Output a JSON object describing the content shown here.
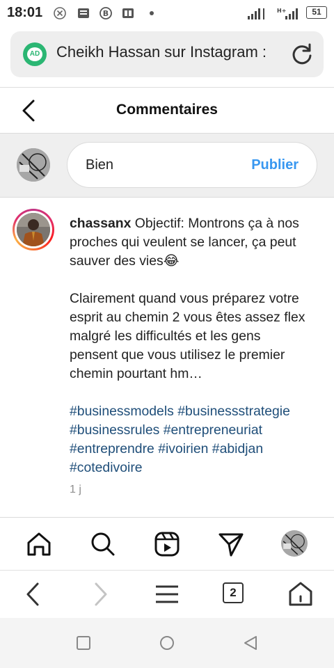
{
  "status_bar": {
    "time": "18:01",
    "battery": "51"
  },
  "browser": {
    "ad_label": "AD",
    "tab_title": "Cheikh Hassan sur Instagram :",
    "tabs_count": "2"
  },
  "header": {
    "title": "Commentaires"
  },
  "compose": {
    "input_value": "Bien",
    "publish_label": "Publier"
  },
  "caption": {
    "username": "chassanx",
    "line1": "Objectif: Montrons ça à nos proches qui veulent se lancer, ça peut sauver des vies😂",
    "line2": "Clairement quand vous préparez votre esprit au chemin 2 vous êtes assez flex malgré les difficultés et les gens pensent que vous utilisez le premier chemin pourtant hm…",
    "hashtags": "#businessmodels #businessstrategie #businessrules #entrepreneuriat #entreprendre #ivoirien #abidjan #cotedivoire",
    "time_ago": "1 j"
  },
  "colors": {
    "accent": "#3897f0",
    "hashtag": "#1f4e79",
    "ad_green": "#2bb673"
  },
  "icons": {
    "ig_nav": [
      "home-icon",
      "search-icon",
      "reels-icon",
      "direct-icon",
      "profile-avatar"
    ],
    "browser_nav": [
      "back-icon",
      "forward-icon",
      "menu-icon",
      "tabs-icon",
      "home-icon"
    ],
    "android_nav": [
      "recents-icon",
      "home-icon",
      "back-icon"
    ]
  }
}
